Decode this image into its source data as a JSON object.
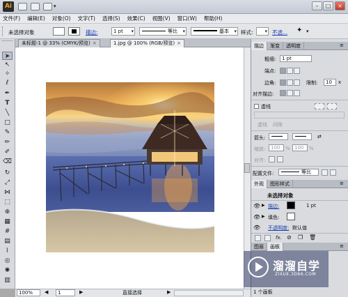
{
  "app": {
    "logo": "Ai",
    "min": "–",
    "max": "□",
    "close": "×"
  },
  "menu": [
    "文件(F)",
    "编辑(E)",
    "对象(O)",
    "文字(T)",
    "选择(S)",
    "效果(C)",
    "视图(V)",
    "窗口(W)",
    "帮助(H)"
  ],
  "control_bar": {
    "selection_label": "未选择对象",
    "stroke_label": "描边:",
    "stroke_width": "1 pt",
    "profile_label": "等比",
    "brush_label": "基本",
    "style_label": "样式:",
    "opacity_label": "不透..."
  },
  "documents": {
    "tab1": "未标题-1 @ 33% (CMYK/预览)",
    "tab2": "1.jpg @ 100% (RGB/预览)"
  },
  "status_bar": {
    "zoom": "100%",
    "artboard": "1",
    "tool": "直接选择"
  },
  "stroke_panel": {
    "tabs": [
      "描边",
      "渐变",
      "透明度"
    ],
    "weight_label": "粗细:",
    "weight_value": "1 pt",
    "cap_label": "端点:",
    "corner_label": "边角:",
    "limit_label": "限制:",
    "limit_value": "10",
    "x_suffix": "x",
    "align_label": "对齐描边:",
    "dashed_label": "虚线",
    "dash_label": "虚线",
    "gap_label": "间隙",
    "arrow_label": "箭头:",
    "scale_label": "缩放:",
    "scale_value_1": "100",
    "scale_value_2": "100",
    "pct": "%",
    "arrow_align_label": "对齐:",
    "profile_label": "配置文件:",
    "profile_value": "等比"
  },
  "appearance_panel": {
    "tabs": [
      "外观",
      "图形样式"
    ],
    "header": "未选择对象",
    "stroke_label": "描边:",
    "stroke_value": "1 pt",
    "fill_label": "填色:",
    "opacity_label": "不透明度:",
    "opacity_value": "默认值",
    "fx_label": "fx."
  },
  "layers_panel": {
    "tabs": [
      "图层",
      "画板"
    ],
    "status": "1 个画板"
  },
  "watermark": {
    "title": "溜溜自学",
    "sub": "ZIXUE.3D66.COM"
  },
  "colors": {
    "accent_link": "#1a3fae",
    "title_bar": "#d8dde5",
    "panel_bg": "#d9dbdf"
  }
}
